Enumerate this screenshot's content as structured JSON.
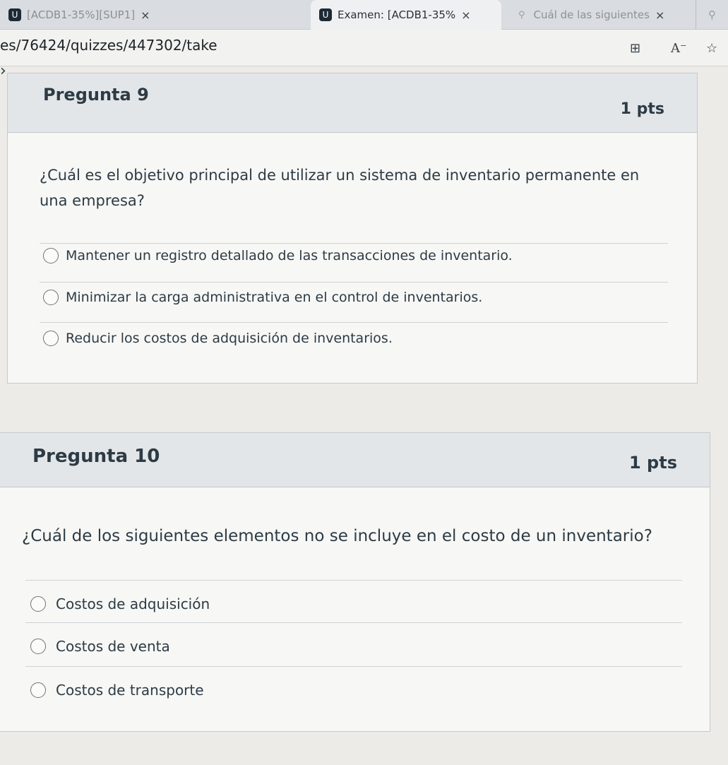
{
  "browser": {
    "tabs": [
      {
        "label": "[ACDB1-35%][SUP1]",
        "favicon": "U",
        "active": false
      },
      {
        "label": "Examen: [ACDB1-35%",
        "favicon": "U",
        "active": true
      },
      {
        "label": "Cuál de las siguientes",
        "favicon": "search",
        "active": false
      },
      {
        "label": "",
        "favicon": "search",
        "active": false
      }
    ],
    "close_glyph": "×",
    "url": "es/76424/quizzes/447302/take"
  },
  "questions": [
    {
      "title": "Pregunta 9",
      "points": "1 pts",
      "text": "¿Cuál es el objetivo principal de utilizar un sistema de inventario permanente en una empresa?",
      "options": [
        "Mantener un registro detallado de las transacciones de inventario.",
        "Minimizar la carga administrativa en el control de inventarios.",
        "Reducir los costos de adquisición de inventarios."
      ]
    },
    {
      "title": "Pregunta 10",
      "points": "1 pts",
      "text": "¿Cuál de los siguientes elementos no se incluye en el costo de un inventario?",
      "options": [
        "Costos de adquisición",
        "Costos de venta",
        "Costos de transporte"
      ]
    }
  ],
  "colors": {
    "text": "#2d3b45",
    "header_bg": "#e3e6e9",
    "card_bg": "#f7f7f5",
    "page_bg": "#ecebe7"
  }
}
